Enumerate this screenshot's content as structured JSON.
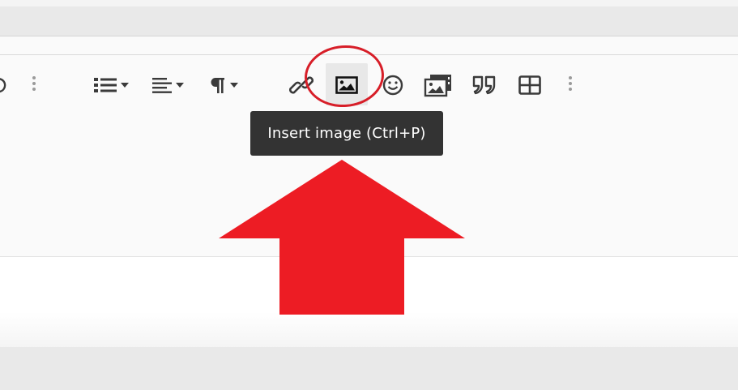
{
  "toolbar": {
    "buttons": [
      {
        "name": "undo-partial",
        "icon": "undo-icon"
      },
      {
        "name": "bulleted-list",
        "icon": "bulleted-list-icon",
        "dropdown": true
      },
      {
        "name": "alignment",
        "icon": "align-left-icon",
        "dropdown": true
      },
      {
        "name": "paragraph-format",
        "icon": "pilcrow-icon",
        "dropdown": true
      },
      {
        "name": "insert-link",
        "icon": "link-icon"
      },
      {
        "name": "insert-image",
        "icon": "image-icon",
        "active": true
      },
      {
        "name": "emoticons",
        "icon": "smiley-icon"
      },
      {
        "name": "insert-gallery",
        "icon": "gallery-icon"
      },
      {
        "name": "blockquote",
        "icon": "quote-icon"
      },
      {
        "name": "insert-table",
        "icon": "table-icon"
      }
    ]
  },
  "tooltip": {
    "text": "Insert image (Ctrl+P)"
  },
  "colors": {
    "annotation_red": "#ed1c24",
    "ring_red": "#d71e28",
    "tooltip_bg": "#333333",
    "icon": "#3a3a3a"
  }
}
